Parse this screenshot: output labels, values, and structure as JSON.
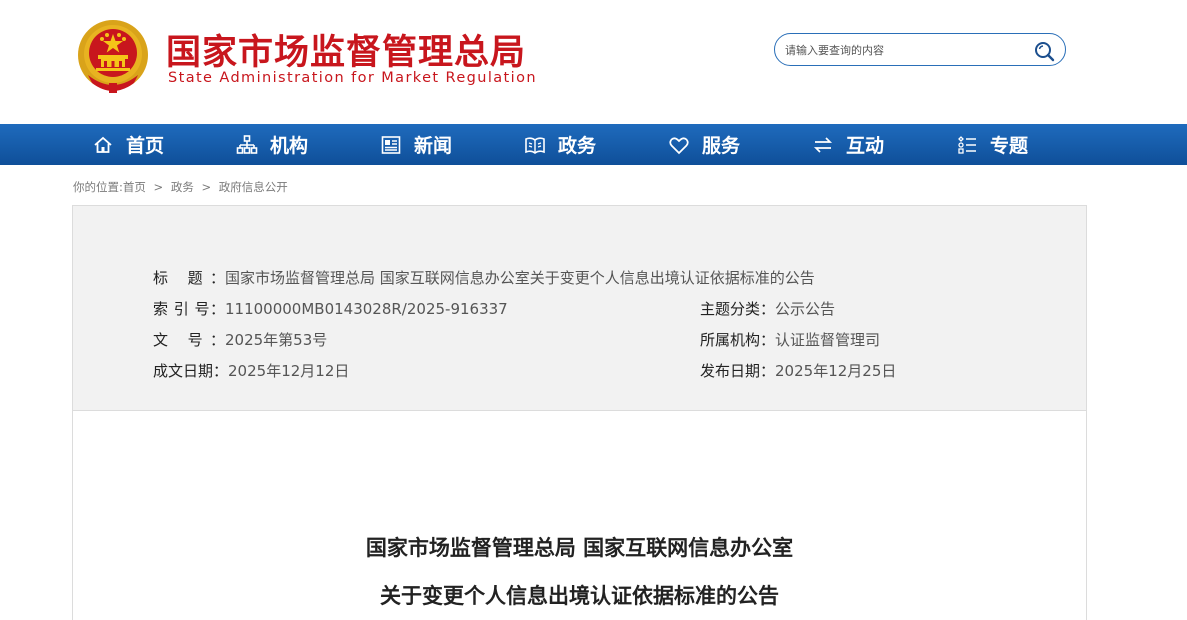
{
  "header": {
    "brand_cn": "国家市场监督管理总局",
    "brand_en": "State Administration for Market Regulation",
    "search_placeholder": "请输入要查询的内容"
  },
  "nav": {
    "items": [
      {
        "label": "首页",
        "icon": "home-icon"
      },
      {
        "label": "机构",
        "icon": "org-chart-icon"
      },
      {
        "label": "新闻",
        "icon": "news-icon"
      },
      {
        "label": "政务",
        "icon": "book-icon"
      },
      {
        "label": "服务",
        "icon": "heart-icon"
      },
      {
        "label": "互动",
        "icon": "exchange-icon"
      },
      {
        "label": "专题",
        "icon": "list-icon"
      }
    ]
  },
  "breadcrumb": {
    "prefix": "你的位置:首页",
    "sep": ">",
    "items": [
      "政务",
      "政府信息公开"
    ]
  },
  "meta": {
    "title_label": "标 题：",
    "title_value": "国家市场监督管理总局 国家互联网信息办公室关于变更个人信息出境认证依据标准的公告",
    "index_label": "索 引 号：",
    "index_value": "11100000MB0143028R/2025-916337",
    "doc_no_label": "文 号：",
    "doc_no_value": "2025年第53号",
    "date_created_label": "成文日期：",
    "date_created_value": "2025年12月12日",
    "category_label": "主题分类：",
    "category_value": "公示公告",
    "org_label": "所属机构：",
    "org_value": "认证监督管理司",
    "date_published_label": "发布日期：",
    "date_published_value": "2025年12月25日"
  },
  "document": {
    "title_line1": "国家市场监督管理总局 国家互联网信息办公室",
    "title_line2": "关于变更个人信息出境认证依据标准的公告"
  },
  "colors": {
    "brand_red": "#c8161d",
    "nav_blue": "#1a5fae",
    "meta_bg": "#f2f2f2"
  }
}
